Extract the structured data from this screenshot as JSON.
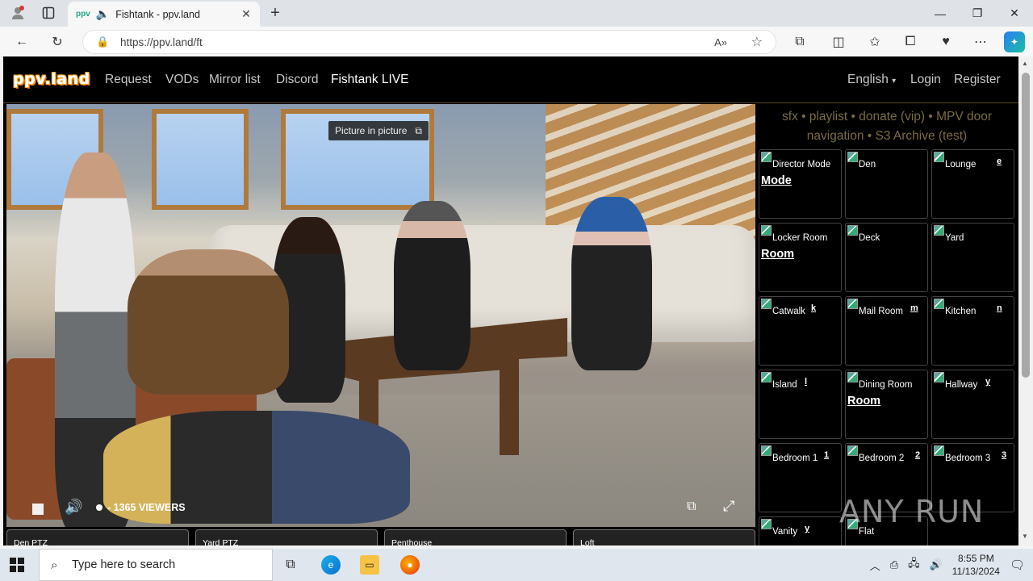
{
  "browser": {
    "tab_title": "Fishtank - ppv.land",
    "url": "https://ppv.land/ft",
    "pip_label": "Picture in picture"
  },
  "site": {
    "logo": "ppv.land",
    "nav": [
      "Request",
      "VODs",
      "Mirror list",
      "Discord",
      "Fishtank LIVE"
    ],
    "language": "English",
    "login": "Login",
    "register": "Register"
  },
  "player": {
    "viewers": "- 1365 VIEWERS"
  },
  "side_links": {
    "line1": "sfx • playlist • donate (vip) • MPV door",
    "line2": "navigation • S3 Archive (test)"
  },
  "cams": [
    {
      "label": "Director Mode",
      "alt": "Mode"
    },
    {
      "label": "Den",
      "alt": ""
    },
    {
      "label": "Lounge",
      "alt": "e"
    },
    {
      "label": "Locker Room",
      "alt": "Room"
    },
    {
      "label": "Deck",
      "alt": ""
    },
    {
      "label": "Yard",
      "alt": ""
    },
    {
      "label": "Catwalk",
      "alt": "k"
    },
    {
      "label": "Mail Room",
      "alt": "m"
    },
    {
      "label": "Kitchen",
      "alt": "n"
    },
    {
      "label": "Island",
      "alt": "l"
    },
    {
      "label": "Dining Room",
      "alt": "Room"
    },
    {
      "label": "Hallway",
      "alt": "y"
    },
    {
      "label": "Bedroom 1",
      "alt": "1"
    },
    {
      "label": "Bedroom 2",
      "alt": "2"
    },
    {
      "label": "Bedroom 3",
      "alt": "3"
    },
    {
      "label": "Vanity",
      "alt": "y"
    },
    {
      "label": "Flat",
      "alt": ""
    }
  ],
  "thumbs": [
    "Den PTZ",
    "Yard PTZ",
    "Penthouse",
    "Loft"
  ],
  "watermark": "ANY RUN",
  "taskbar": {
    "search_placeholder": "Type here to search",
    "time": "8:55 PM",
    "date": "11/13/2024"
  }
}
